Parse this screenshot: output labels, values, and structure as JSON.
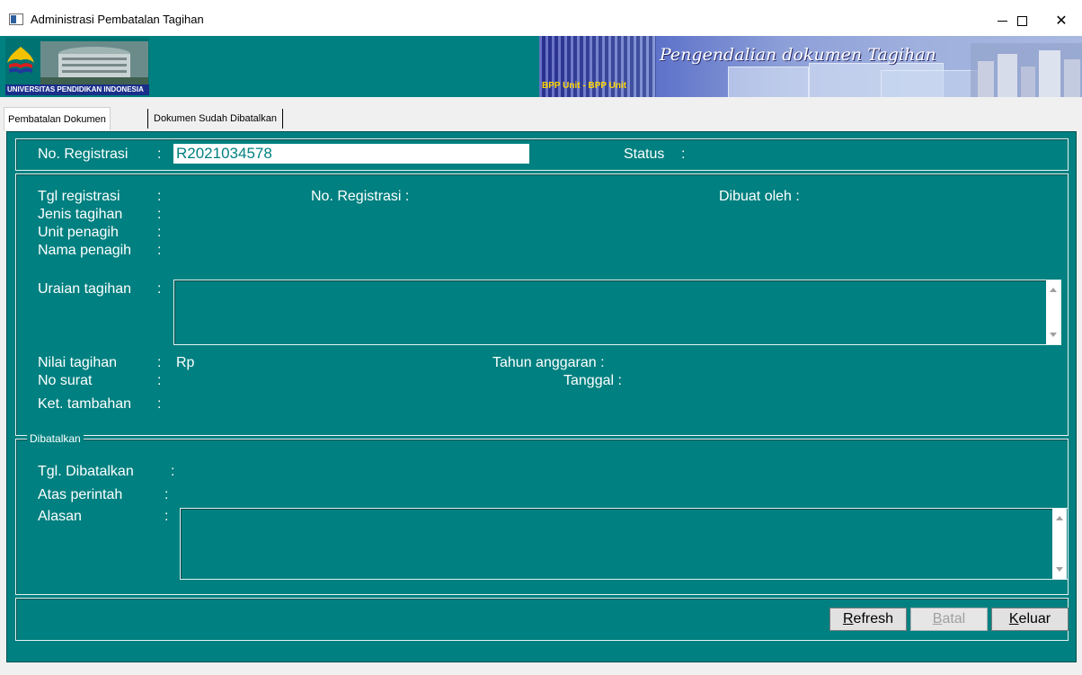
{
  "window": {
    "title": "Administrasi Pembatalan Tagihan",
    "minimize_glyph": "—",
    "close_glyph": "✕"
  },
  "banner": {
    "logo_caption": "UNIVERSITAS PENDIDIKAN INDONESIA",
    "unit_label": "BPP Unit - BPP Unit",
    "slogan": "Pengendalian dokumen Tagihan"
  },
  "tabs": [
    {
      "label": "Pembatalan Dokumen",
      "active": true
    },
    {
      "label": "Dokumen Sudah Dibatalkan",
      "active": false
    }
  ],
  "header": {
    "no_registrasi_label": "No. Registrasi",
    "no_registrasi_value": "R2021034578",
    "status_label": "Status",
    "colon": ":"
  },
  "detail": {
    "tgl_registrasi": "Tgl registrasi",
    "jenis_tagihan": "Jenis tagihan",
    "unit_penagih": "Unit penagih",
    "nama_penagih": "Nama penagih",
    "uraian_tagihan": "Uraian tagihan",
    "nilai_tagihan": "Nilai tagihan",
    "nilai_prefix": "Rp",
    "no_surat": "No surat",
    "ket_tambahan": "Ket. tambahan",
    "no_registrasi": "No. Registrasi :",
    "dibuat_oleh": "Dibuat oleh :",
    "tahun_anggaran": "Tahun anggaran :",
    "tanggal": "Tanggal :",
    "colon": ":"
  },
  "dibatalkan": {
    "legend": "Dibatalkan",
    "tgl_dibatalkan": "Tgl. Dibatalkan",
    "atas_perintah": "Atas perintah",
    "alasan": "Alasan",
    "colon": ":"
  },
  "buttons": {
    "refresh_first": "R",
    "refresh_rest": "efresh",
    "batal_first": "B",
    "batal_rest": "atal",
    "keluar_first": "K",
    "keluar_rest": "eluar"
  },
  "colors": {
    "panel": "#008080",
    "button_face": "#e1e1e1",
    "logo_caption_bg": "#1a2f8a",
    "unit_label": "#ffd700"
  }
}
